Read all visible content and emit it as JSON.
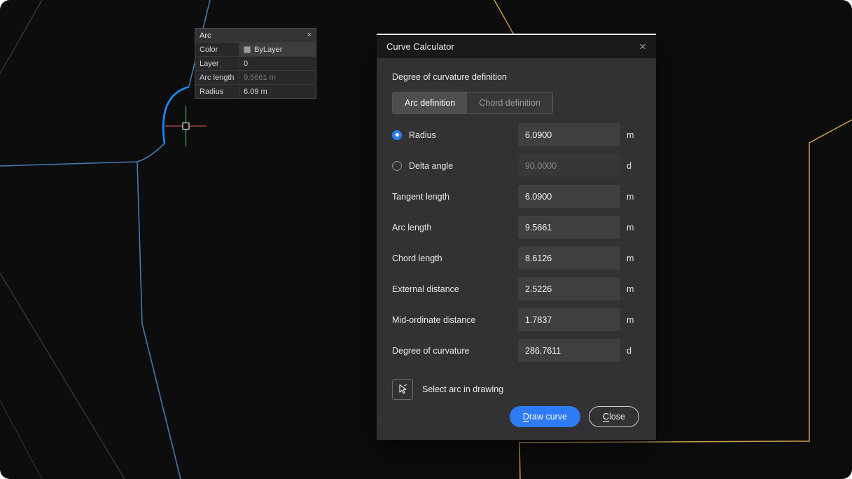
{
  "colors": {
    "accent_blue": "#2e7bf6",
    "selected_entity": "#1e88ff",
    "drawing_blue": "#4878b0",
    "drawing_yellow": "#c7a14b",
    "canvas_background": "#0d0d0e"
  },
  "arc_panel": {
    "title": "Arc",
    "close": "×",
    "rows": [
      {
        "label": "Color",
        "value": "ByLayer"
      },
      {
        "label": "Layer",
        "value": "0"
      },
      {
        "label": "Arc length",
        "value": "9.5661 m"
      },
      {
        "label": "Radius",
        "value": "6.09 m"
      }
    ]
  },
  "dialog": {
    "title": "Curve Calculator",
    "close": "×",
    "section_label": "Degree of curvature definition",
    "tabs": [
      {
        "label": "Arc definition"
      },
      {
        "label": "Chord definition"
      }
    ],
    "fields": [
      {
        "label": "Radius",
        "value": "6.0900",
        "unit": "m"
      },
      {
        "label": "Delta angle",
        "value": "90.0000",
        "unit": "d"
      },
      {
        "label": "Tangent length",
        "value": "6.0900",
        "unit": "m"
      },
      {
        "label": "Arc length",
        "value": "9.5661",
        "unit": "m"
      },
      {
        "label": "Chord length",
        "value": "8.6126",
        "unit": "m"
      },
      {
        "label": "External distance",
        "value": "2.5226",
        "unit": "m"
      },
      {
        "label": "Mid-ordinate distance",
        "value": "1.7837",
        "unit": "m"
      },
      {
        "label": "Degree of curvature",
        "value": "286.7611",
        "unit": "d"
      }
    ],
    "select_arc_label": "Select arc in drawing",
    "buttons": {
      "draw": "Draw curve",
      "close": "Close"
    }
  }
}
